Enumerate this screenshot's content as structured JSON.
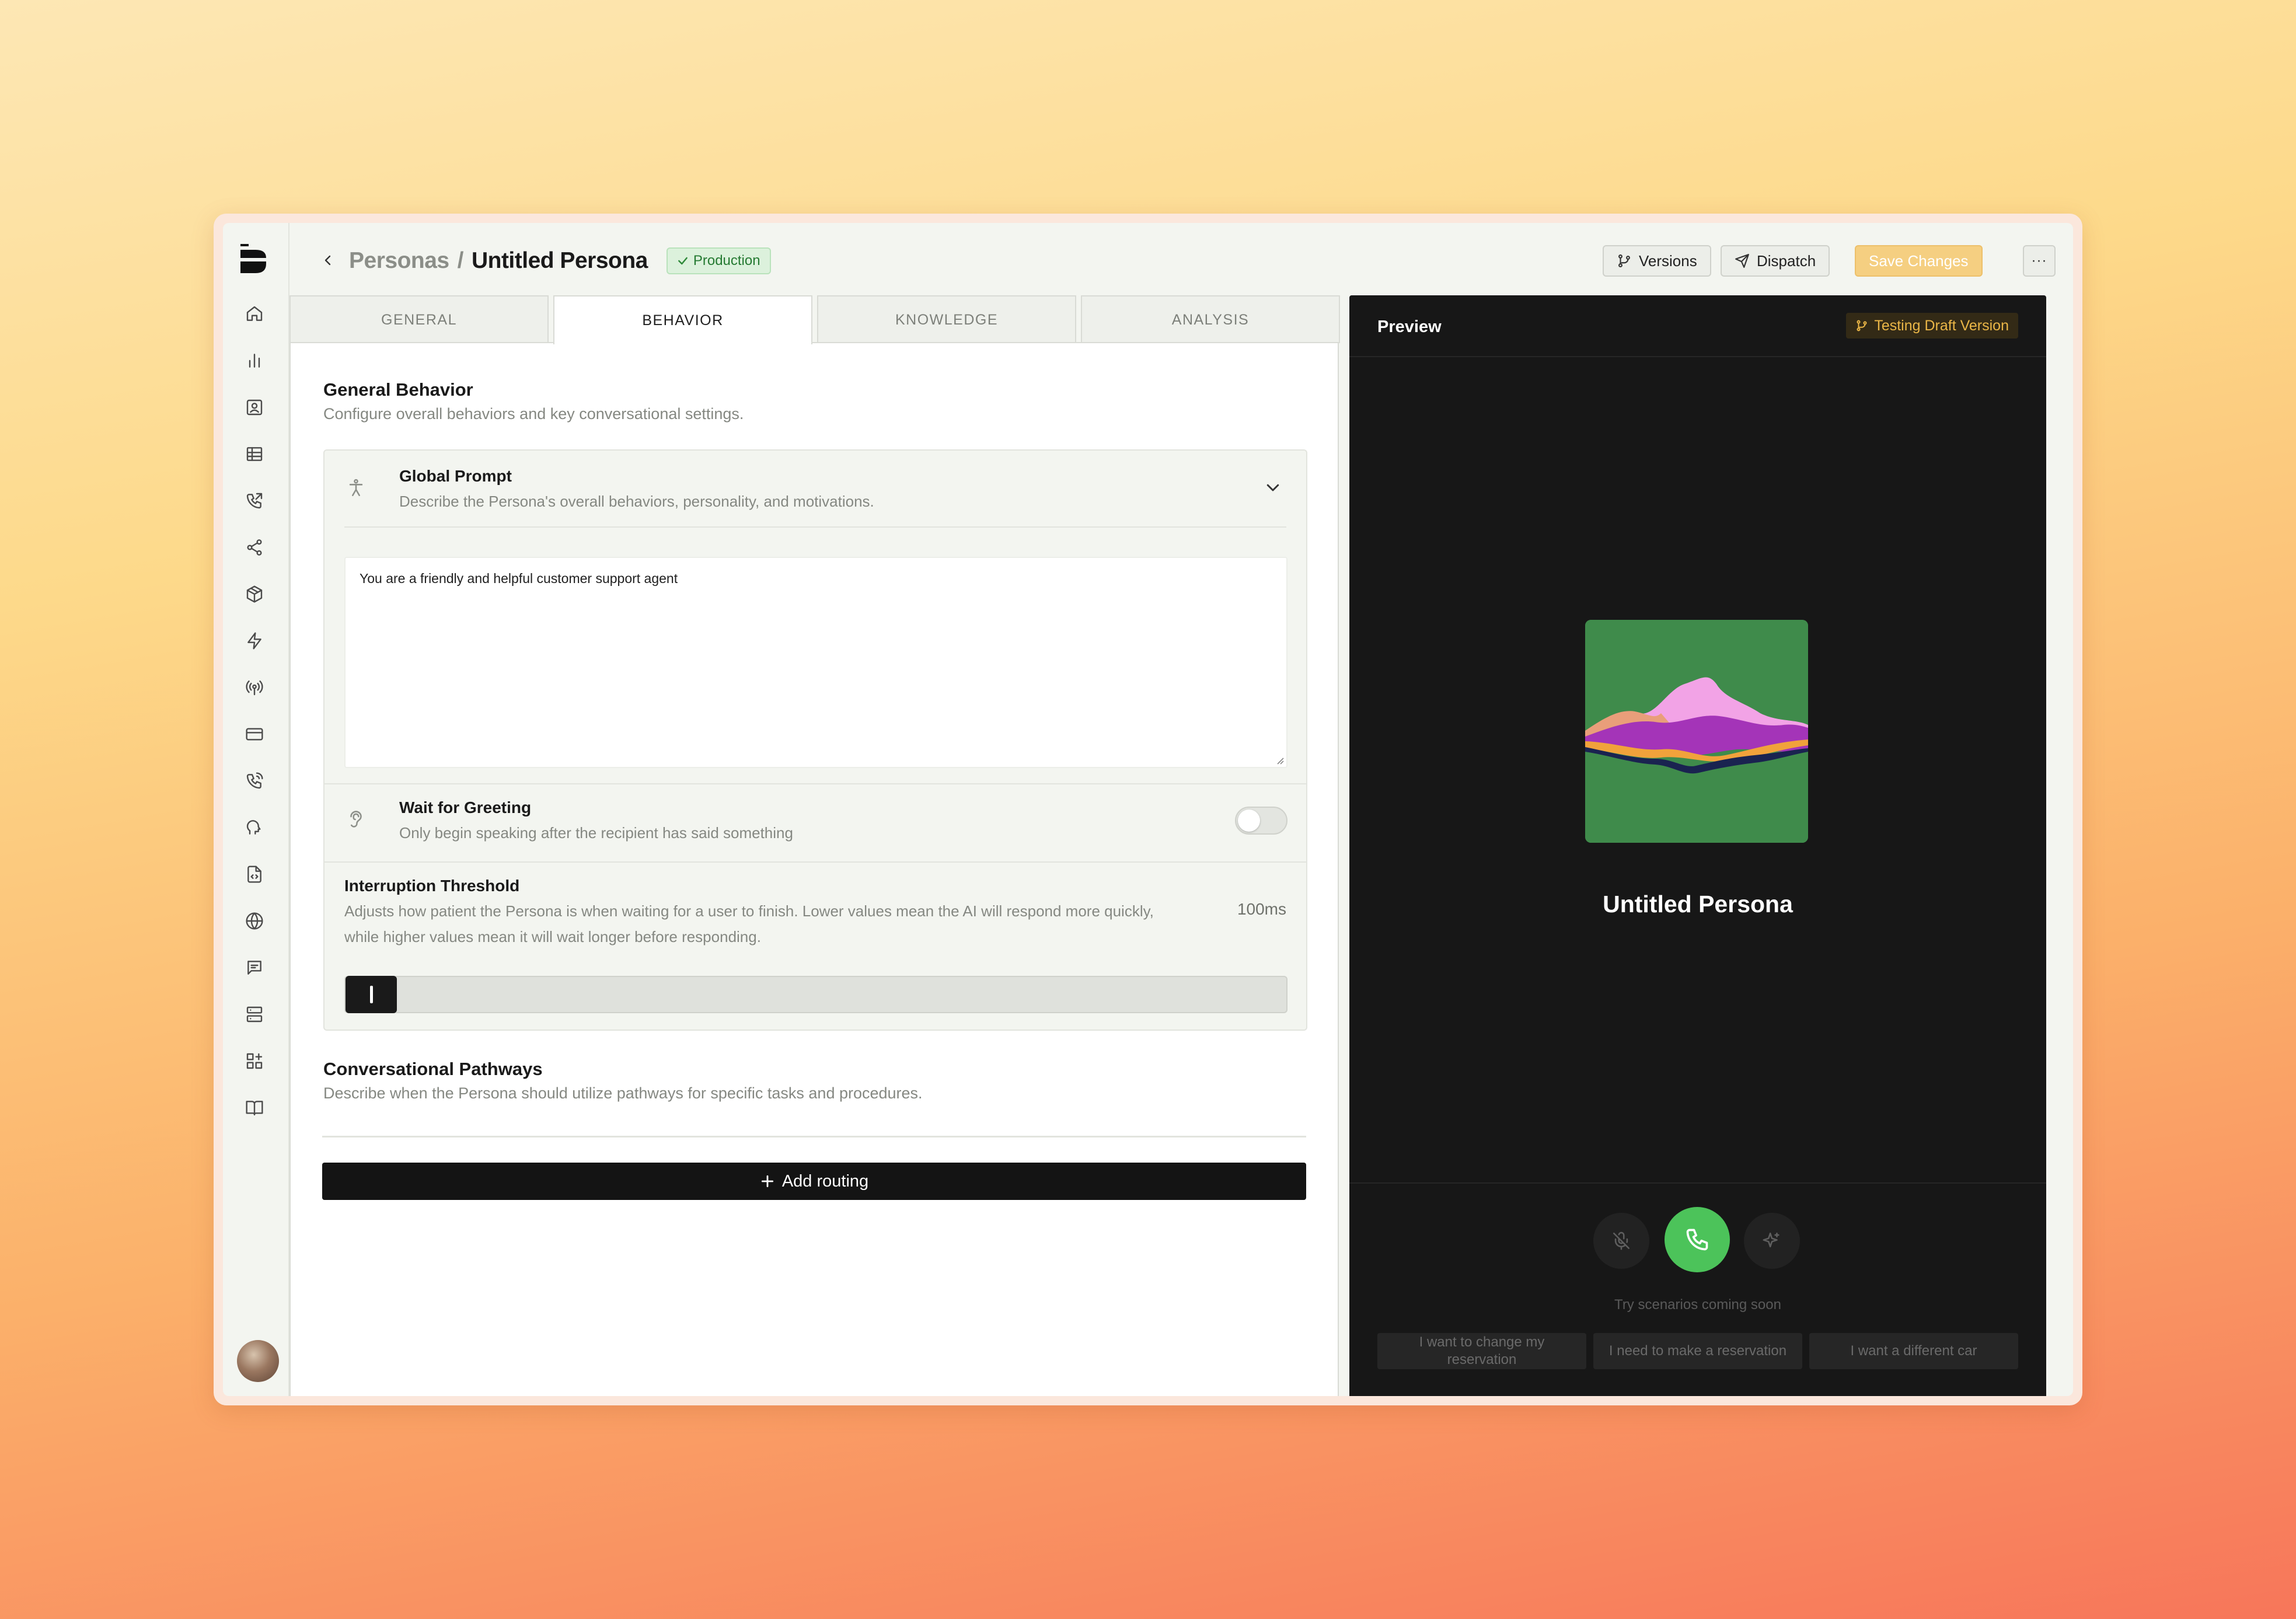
{
  "header": {
    "breadcrumb_parent": "Personas",
    "breadcrumb_separator": "/",
    "title": "Untitled Persona",
    "status_badge": "Production",
    "versions_label": "Versions",
    "dispatch_label": "Dispatch",
    "save_label": "Save Changes",
    "more_label": "···"
  },
  "sidebar": {
    "items": [
      "home-icon",
      "bar-chart-icon",
      "contact-card-icon",
      "table-icon",
      "phone-outgoing-icon",
      "share-icon",
      "package-icon",
      "zap-icon",
      "broadcast-icon",
      "credit-card-icon",
      "phone-call-icon",
      "voice-icon",
      "file-code-icon",
      "globe-icon",
      "message-icon",
      "server-icon",
      "widgets-icon",
      "book-icon"
    ]
  },
  "tabs": [
    "GENERAL",
    "BEHAVIOR",
    "KNOWLEDGE",
    "ANALYSIS"
  ],
  "active_tab": "BEHAVIOR",
  "general_behavior": {
    "title": "General Behavior",
    "description": "Configure overall behaviors and key conversational settings.",
    "global_prompt": {
      "title": "Global Prompt",
      "description": "Describe the Persona's overall behaviors, personality, and motivations.",
      "value": "You are a friendly and helpful customer support agent"
    },
    "wait_for_greeting": {
      "title": "Wait for Greeting",
      "description": "Only begin speaking after the recipient has said something",
      "enabled": false
    },
    "interruption_threshold": {
      "title": "Interruption Threshold",
      "description_line1": "Adjusts how patient the Persona is when waiting for a user to finish. Lower values mean the AI will respond more quickly,",
      "description_line2": "while higher values mean it will wait longer before responding.",
      "value_label": "100ms",
      "value": 100
    }
  },
  "pathways": {
    "title": "Conversational Pathways",
    "description": "Describe when the Persona should utilize pathways for specific tasks and procedures.",
    "add_label": "Add routing"
  },
  "preview": {
    "title": "Preview",
    "badge": "Testing Draft Version",
    "persona_name": "Untitled Persona",
    "scenario_hint": "Try scenarios coming soon",
    "scenarios": [
      "I want to change my reservation",
      "I need to make a reservation",
      "I want a different car"
    ]
  },
  "colors": {
    "accent_green": "#4cc35a",
    "badge_green_bg": "#dcf1dc",
    "save_yellow": "#f5cf81",
    "preview_bg": "#171717",
    "draft_badge": "#eab647"
  }
}
